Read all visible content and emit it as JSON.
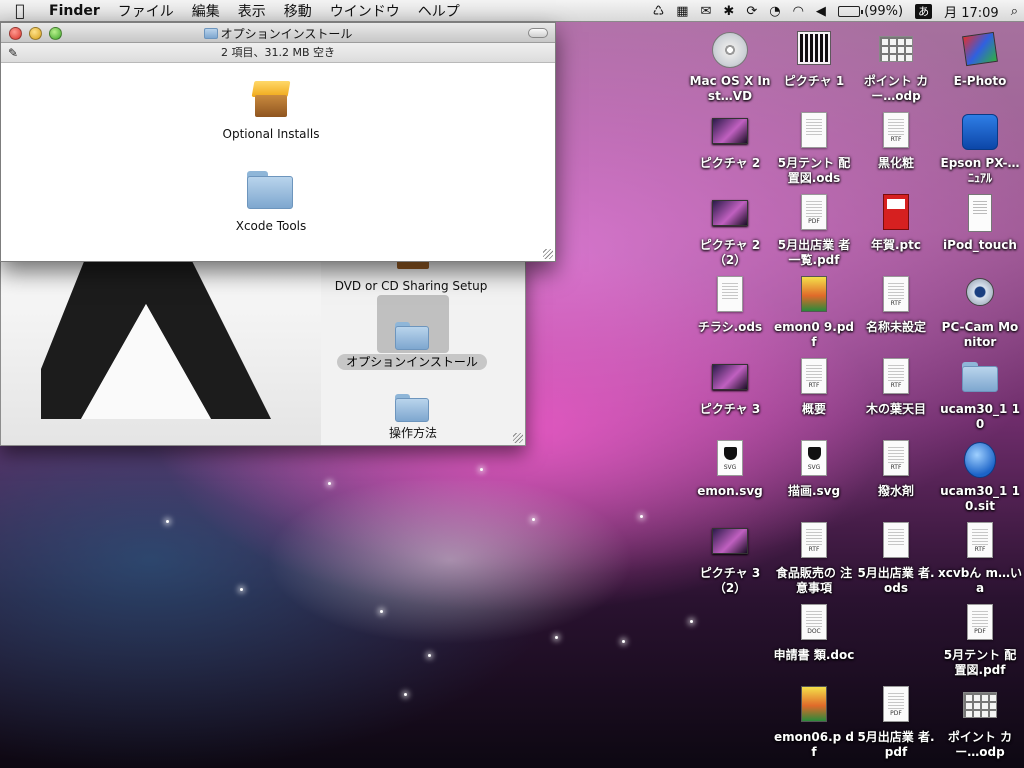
{
  "menubar": {
    "apple": "",
    "app_name": "Finder",
    "items": [
      "ファイル",
      "編集",
      "表示",
      "移動",
      "ウインドウ",
      "ヘルプ"
    ],
    "status": {
      "bluetooth": "✱",
      "sync": "⟳",
      "timemachine": "◔",
      "wifi": "◠",
      "volume": "◀",
      "battery": "(99%)",
      "ime": "あ",
      "clock": "月 17:09",
      "spotlight": "⌕"
    }
  },
  "back_window": {
    "items": [
      {
        "label": "DVD or CD Sharing Setup"
      },
      {
        "label": "オプションインストール"
      },
      {
        "label": "操作方法"
      }
    ]
  },
  "front_window": {
    "title": "オプションインストール",
    "status": "2 項目、31.2 MB 空き",
    "items": [
      {
        "label": "Optional Installs"
      },
      {
        "label": "Xcode Tools"
      }
    ]
  },
  "desktop": {
    "icons": [
      {
        "label": "Mac OS X Inst…VD",
        "icon": "dvd-disc-icon"
      },
      {
        "label": "ピクチャ 1",
        "icon": "qr-image-icon"
      },
      {
        "label": "ポイント カー…odp",
        "icon": "presentation-icon"
      },
      {
        "label": "E-Photo",
        "icon": "ephoto-app-icon"
      },
      {
        "label": "ピクチャ 2",
        "icon": "screenshot-icon"
      },
      {
        "label": "5月テント 配置図.ods",
        "icon": "spreadsheet-icon"
      },
      {
        "label": "黒化粧",
        "icon": "rtf-doc-icon",
        "ext": "RTF"
      },
      {
        "label": "Epson PX-…ﾆｭｱﾙ",
        "icon": "epson-app-icon"
      },
      {
        "label": "ピクチャ 2（2）",
        "icon": "screenshot-icon"
      },
      {
        "label": "5月出店業 者一覧.pdf",
        "icon": "pdf-doc-icon",
        "ext": "PDF"
      },
      {
        "label": "年賀.ptc",
        "icon": "ptc-doc-icon"
      },
      {
        "label": "iPod_touch",
        "icon": "text-doc-icon"
      },
      {
        "label": "チラシ.ods",
        "icon": "spreadsheet-icon"
      },
      {
        "label": "emon0 9.pdf",
        "icon": "magazine-icon"
      },
      {
        "label": "名称未設定",
        "icon": "rtf-doc-icon",
        "ext": "RTF"
      },
      {
        "label": "PC-Cam Monitor",
        "icon": "webcam-app-icon"
      },
      {
        "label": "ピクチャ 3",
        "icon": "screenshot-icon"
      },
      {
        "label": "概要",
        "icon": "rtf-doc-icon",
        "ext": "RTF"
      },
      {
        "label": "木の葉天目",
        "icon": "rtf-doc-icon",
        "ext": "RTF"
      },
      {
        "label": "ucam30_1 10",
        "icon": "folder-icon"
      },
      {
        "label": "emon.svg",
        "icon": "svg-doc-icon",
        "ext": "SVG"
      },
      {
        "label": "描画.svg",
        "icon": "svg-doc-icon",
        "ext": "SVG"
      },
      {
        "label": "撥水剤",
        "icon": "rtf-doc-icon",
        "ext": "RTF"
      },
      {
        "label": "ucam30_1 10.sit",
        "icon": "stuffit-archive-icon"
      },
      {
        "label": "ピクチャ 3（2）",
        "icon": "screenshot-icon"
      },
      {
        "label": "食品販売の 注意事項",
        "icon": "rtf-doc-icon",
        "ext": "RTF"
      },
      {
        "label": "5月出店業 者.ods",
        "icon": "spreadsheet-icon"
      },
      {
        "label": "xcvbん m…いa",
        "icon": "rtf-doc-icon",
        "ext": "RTF"
      },
      {
        "label": "申請書 類.doc",
        "icon": "doc-icon",
        "ext": "DOC"
      },
      {
        "label": "5月テント 配置図.pdf",
        "icon": "pdf-doc-icon",
        "ext": "PDF"
      },
      {
        "label": "emon06.p df",
        "icon": "magazine-icon"
      },
      {
        "label": "5月出店業 者.pdf",
        "icon": "pdf-doc-icon",
        "ext": "PDF"
      },
      {
        "label": "ポイント カー…odp",
        "icon": "presentation-icon"
      }
    ]
  }
}
